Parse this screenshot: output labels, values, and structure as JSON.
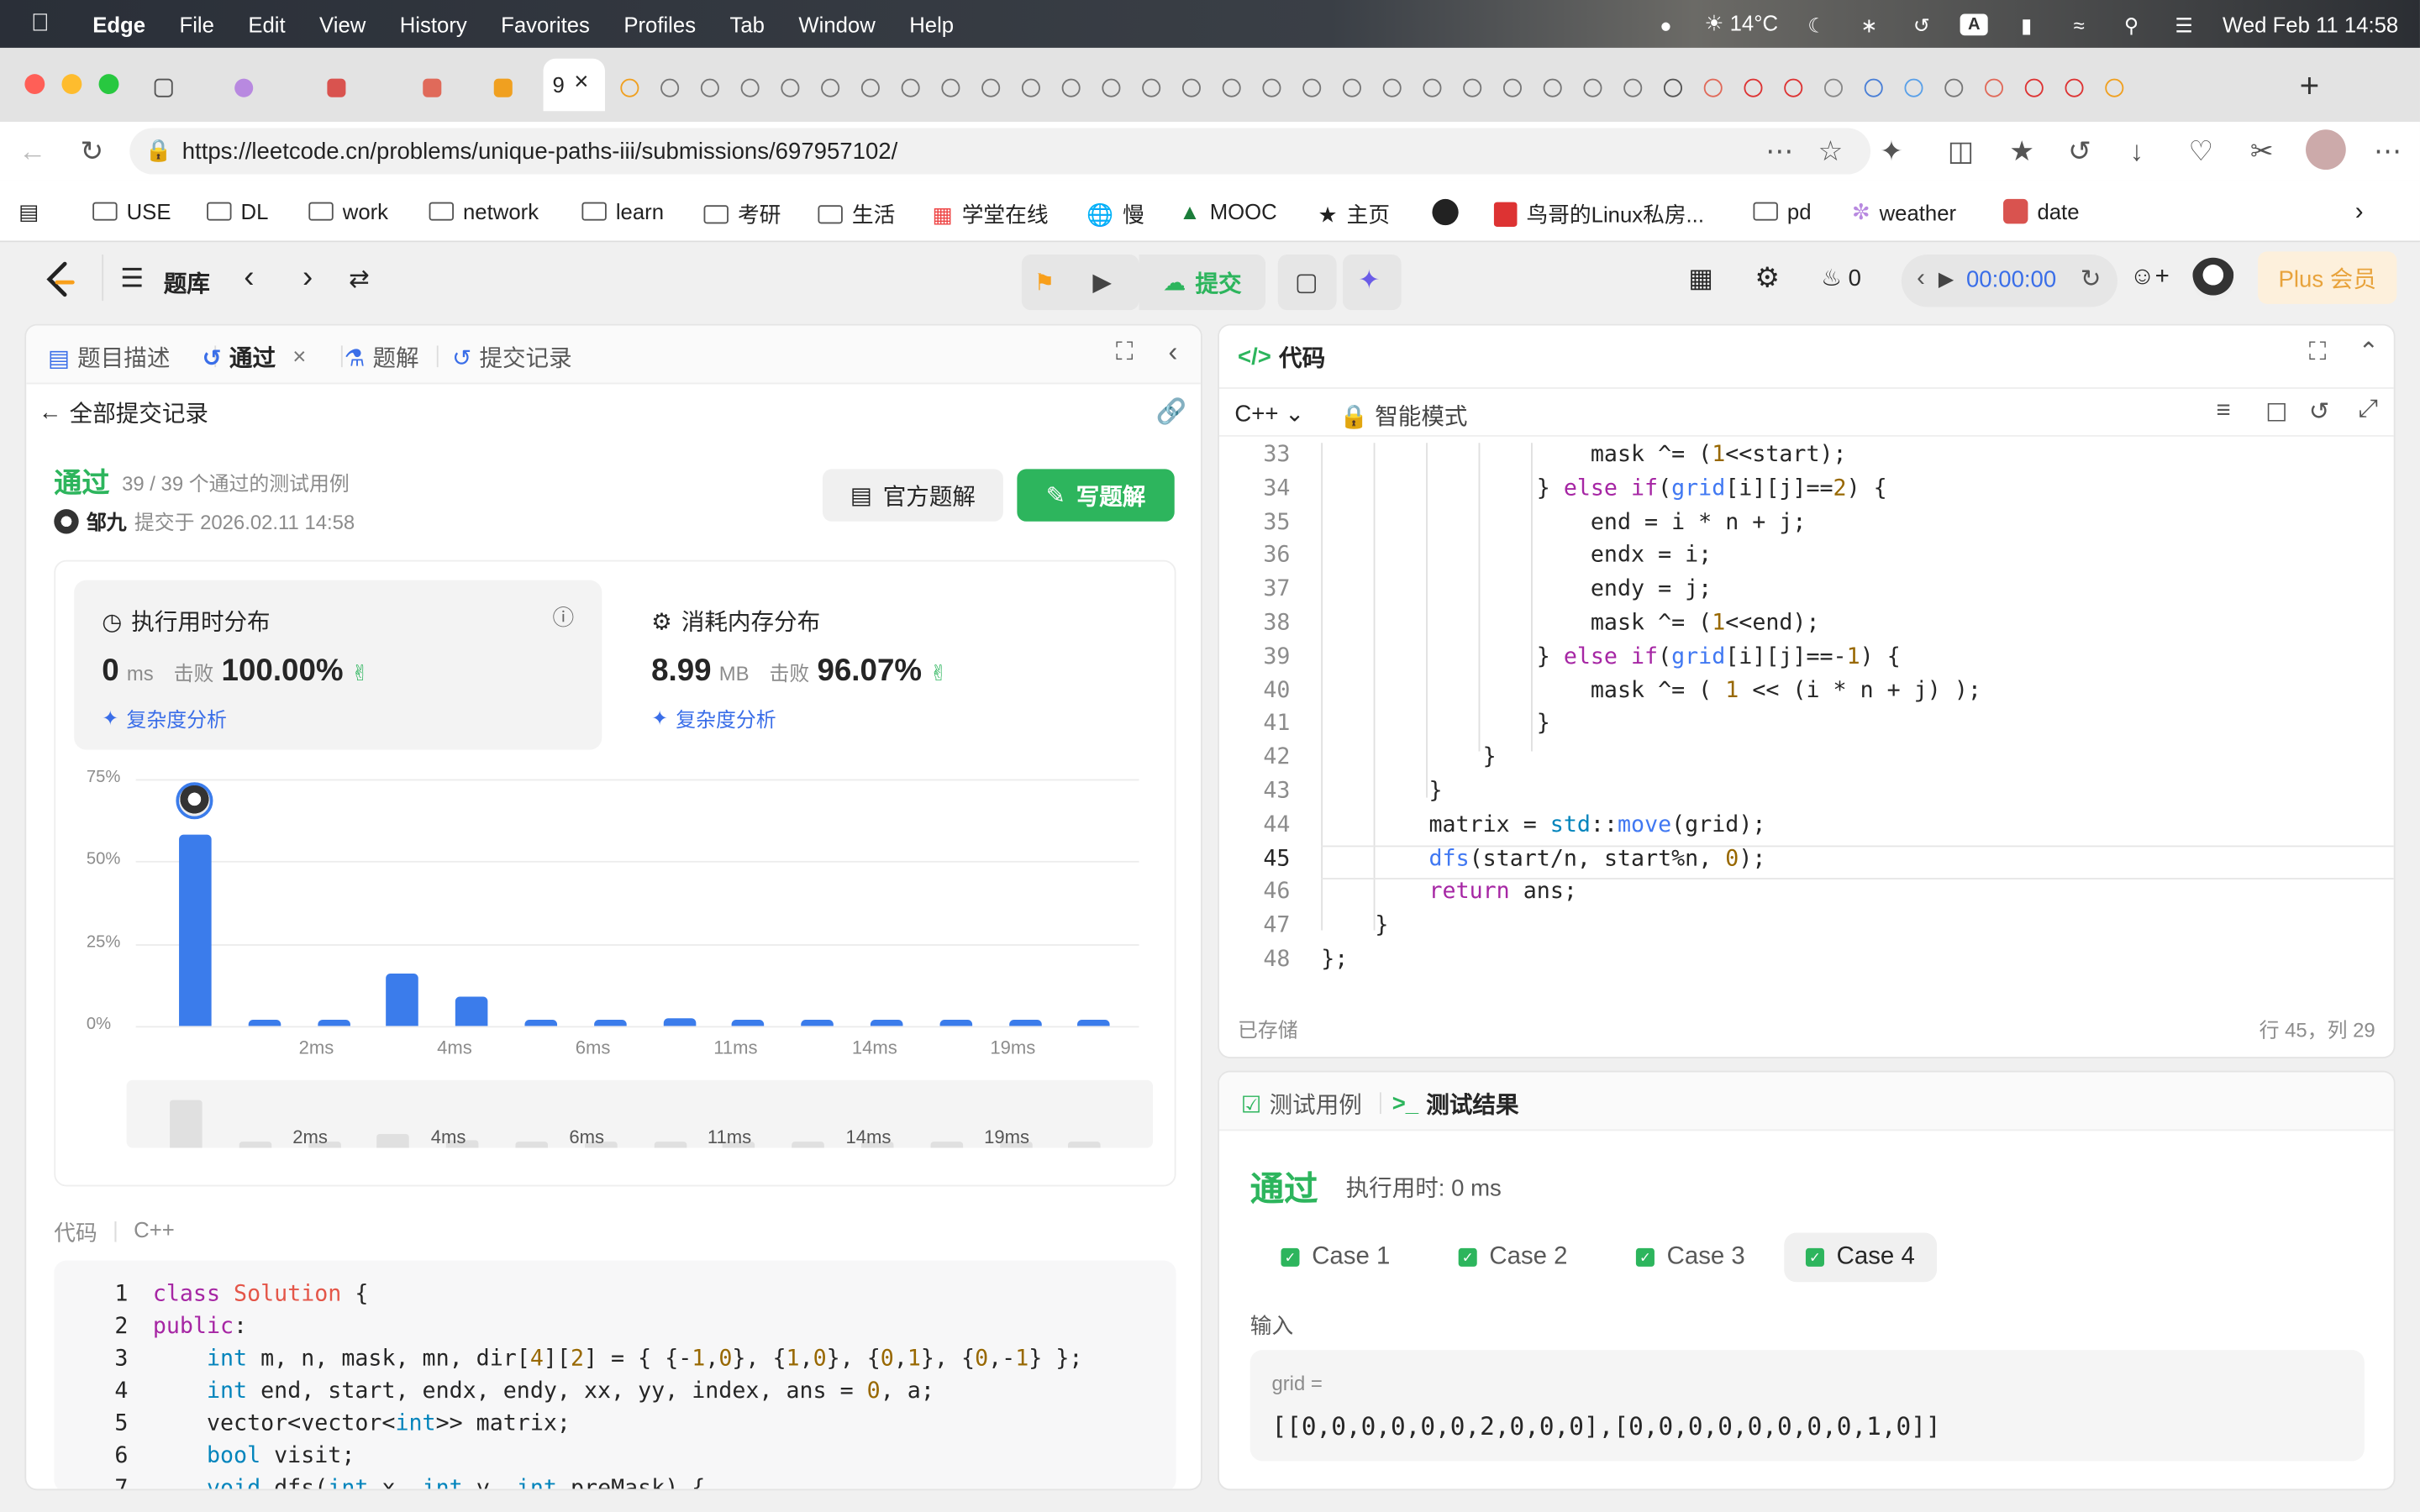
{
  "menubar": {
    "app": "Edge",
    "items": [
      "File",
      "Edit",
      "View",
      "History",
      "Favorites",
      "Profiles",
      "Tab",
      "Window",
      "Help"
    ],
    "weather": "14°C",
    "datetime": "Wed Feb 11  14:58"
  },
  "browser": {
    "url": "https://leetcode.cn/problems/unique-paths-iii/submissions/697957102/",
    "active_tab_label": "9"
  },
  "bookmarks": [
    {
      "label": "USE",
      "icon": "folder-icon"
    },
    {
      "label": "DL",
      "icon": "folder-icon"
    },
    {
      "label": "work",
      "icon": "folder-icon"
    },
    {
      "label": "network",
      "icon": "folder-icon"
    },
    {
      "label": "learn",
      "icon": "folder-icon"
    },
    {
      "label": "考研",
      "icon": "folder-icon"
    },
    {
      "label": "生活",
      "icon": "folder-icon"
    },
    {
      "label": "学堂在线",
      "icon": "grid-icon"
    },
    {
      "label": "慢",
      "icon": "globe-icon"
    },
    {
      "label": "MOOC",
      "icon": "mooc-icon"
    },
    {
      "label": "主页",
      "icon": "star-icon"
    },
    {
      "label": "",
      "icon": "github-icon"
    },
    {
      "label": "鸟哥的Linux私房...",
      "icon": "pdf-icon"
    },
    {
      "label": "pd",
      "icon": "folder-icon"
    },
    {
      "label": "weather",
      "icon": "swirl-icon"
    },
    {
      "label": "date",
      "icon": "calendar-icon"
    }
  ],
  "lc_header": {
    "problem_list": "题库",
    "submit": "提交",
    "streak": "0",
    "timer": "00:00:00",
    "plus": "Plus 会员"
  },
  "left_tabs": {
    "description": "题目描述",
    "accepted": "通过",
    "solutions": "题解",
    "submissions": "提交记录"
  },
  "submission": {
    "back_label": "全部提交记录",
    "status": "通过",
    "testcases": "39 / 39 个通过的测试用例",
    "user": "邹九",
    "submitted_at": "提交于 2026.02.11 14:58",
    "official_solution": "官方题解",
    "write_solution": "写题解"
  },
  "runtime": {
    "title": "执行用时分布",
    "value": "0",
    "unit": "ms",
    "beats_label": "击败",
    "beats": "100.00%",
    "complexity": "复杂度分析"
  },
  "memory": {
    "title": "消耗内存分布",
    "value": "8.99",
    "unit": "MB",
    "beats_label": "击败",
    "beats": "96.07%",
    "complexity": "复杂度分析"
  },
  "chart_data": {
    "type": "bar",
    "title": "",
    "xlabel": "",
    "ylabel": "",
    "y_ticks": [
      "75%",
      "50%",
      "25%",
      "0%"
    ],
    "ylim": [
      0,
      75
    ],
    "x_ticks": [
      "2ms",
      "4ms",
      "6ms",
      "11ms",
      "14ms",
      "19ms"
    ],
    "values": [
      58,
      2,
      2,
      16,
      9,
      2,
      2,
      2.5,
      2,
      2,
      2,
      2,
      2,
      2
    ],
    "highlight_index": 0,
    "mini_x_ticks": [
      "2ms",
      "4ms",
      "6ms",
      "11ms",
      "14ms",
      "19ms"
    ],
    "colors": {
      "bar": "#3b7ceb",
      "mini_bar": "#e0e0e0"
    }
  },
  "code_view": {
    "label": "代码",
    "lang": "C++"
  },
  "editor": {
    "title": "代码",
    "language": "C++",
    "mode": "智能模式",
    "saved": "已存储",
    "position": "行 45，列 29"
  },
  "results": {
    "tab_testcase": "测试用例",
    "tab_result": "测试结果",
    "status": "通过",
    "runtime": "执行用时: 0 ms",
    "cases": [
      "Case 1",
      "Case 2",
      "Case 3",
      "Case 4"
    ],
    "active_case": 3,
    "input_label": "输入",
    "var_name": "grid =",
    "var_value": "[[0,0,0,0,0,0,2,0,0,0],[0,0,0,0,0,0,0,0,1,0]]"
  }
}
